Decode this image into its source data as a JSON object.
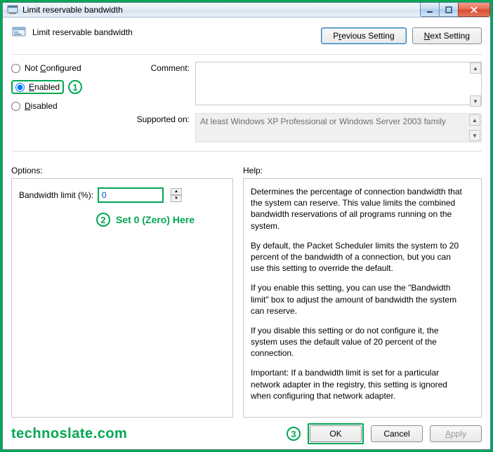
{
  "titlebar": {
    "text": "Limit reservable bandwidth"
  },
  "header": {
    "title": "Limit reservable bandwidth"
  },
  "nav": {
    "prev_pre": "P",
    "prev_key": "r",
    "prev_post": "evious Setting",
    "next_pre": "",
    "next_key": "N",
    "next_post": "ext Setting"
  },
  "radios": {
    "not_configured_pre": "Not ",
    "not_configured_key": "C",
    "not_configured_post": "onfigured",
    "enabled_pre": "",
    "enabled_key": "E",
    "enabled_post": "nabled",
    "disabled_pre": "",
    "disabled_key": "D",
    "disabled_post": "isabled"
  },
  "labels": {
    "comment": "Comment:",
    "supported": "Supported on:",
    "options": "Options:",
    "help": "Help:",
    "bandwidth": "Bandwidth limit (%):"
  },
  "comment_value": "",
  "supported_value": "At least Windows XP Professional or Windows Server 2003 family",
  "bandwidth_value": "0",
  "help": {
    "p1": "Determines the percentage of connection bandwidth that the system can reserve. This value limits the combined bandwidth reservations of all programs running on the system.",
    "p2": "By default, the Packet Scheduler limits the system to 20 percent of the bandwidth of a connection, but you can use this setting to override the default.",
    "p3": "If you enable this setting, you can use the \"Bandwidth limit\" box to adjust the amount of bandwidth the system can reserve.",
    "p4": "If you disable this setting or do not configure it, the system uses the default value of 20 percent of the connection.",
    "p5": "Important: If a bandwidth limit is set for a particular network adapter in the registry, this setting is ignored when configuring that network adapter."
  },
  "buttons": {
    "ok": "OK",
    "cancel": "Cancel",
    "apply_pre": "",
    "apply_key": "A",
    "apply_post": "pply"
  },
  "annotations": {
    "n1": "1",
    "n2": "2",
    "n3": "3",
    "set_zero": "Set 0 (Zero) Here",
    "watermark": "technoslate.com"
  }
}
